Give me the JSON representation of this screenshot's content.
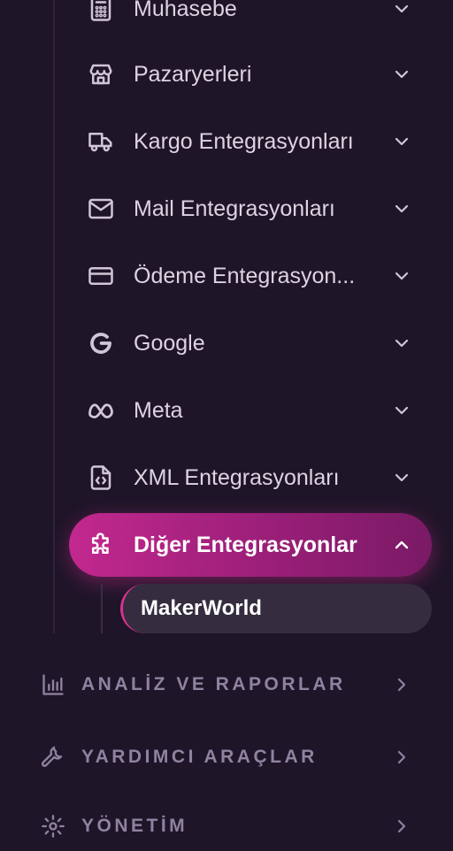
{
  "menu": {
    "items": [
      {
        "label": "Muhasebe",
        "icon": "calculator-icon"
      },
      {
        "label": "Pazaryerleri",
        "icon": "store-icon"
      },
      {
        "label": "Kargo Entegrasyonları",
        "icon": "truck-icon"
      },
      {
        "label": "Mail Entegrasyonları",
        "icon": "mail-icon"
      },
      {
        "label": "Ödeme Entegrasyon...",
        "icon": "credit-card-icon"
      },
      {
        "label": "Google",
        "icon": "google-icon"
      },
      {
        "label": "Meta",
        "icon": "meta-icon"
      },
      {
        "label": "XML Entegrasyonları",
        "icon": "file-code-icon"
      },
      {
        "label": "Diğer Entegrasyonlar",
        "icon": "puzzle-icon",
        "expanded": true
      }
    ],
    "sub_items": [
      {
        "label": "MakerWorld"
      }
    ]
  },
  "sections": [
    {
      "label": "ANALİZ VE RAPORLAR",
      "icon": "bar-chart-icon"
    },
    {
      "label": "YARDIMCI ARAÇLAR",
      "icon": "wrench-icon"
    },
    {
      "label": "YÖNETİM",
      "icon": "gear-icon"
    }
  ],
  "colors": {
    "background": "#1f1528",
    "active_start": "#c2288e",
    "active_end": "#7a1a66",
    "section_text": "#8e83a0"
  }
}
